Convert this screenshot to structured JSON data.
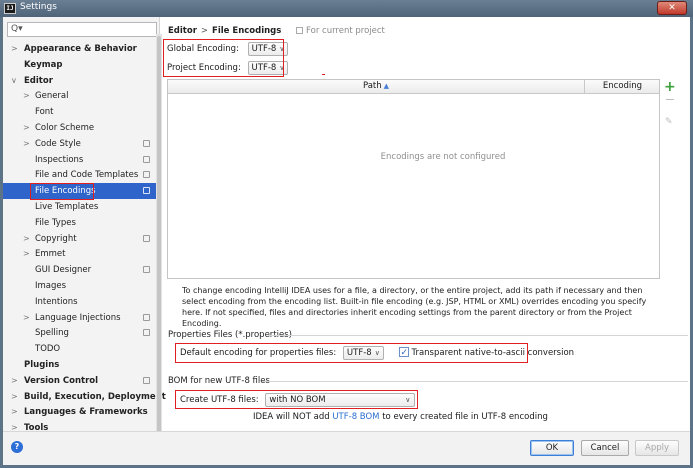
{
  "window": {
    "title": "Settings",
    "app_icon_text": "IJ",
    "close_symbol": "✕"
  },
  "sidebar": {
    "search_icon": "Q▾",
    "search_placeholder": "",
    "items": [
      {
        "label": "Appearance & Behavior",
        "chevron": ">",
        "bold": true
      },
      {
        "label": "Keymap",
        "bold": true
      },
      {
        "label": "Editor",
        "chevron": "∨",
        "bold": true
      },
      {
        "label": "General",
        "chevron": ">"
      },
      {
        "label": "Font"
      },
      {
        "label": "Color Scheme",
        "chevron": ">"
      },
      {
        "label": "Code Style",
        "chevron": ">",
        "project_icon": true
      },
      {
        "label": "Inspections",
        "project_icon": true
      },
      {
        "label": "File and Code Templates",
        "project_icon": true
      },
      {
        "label": "File Encodings",
        "project_icon": true,
        "selected": true
      },
      {
        "label": "Live Templates"
      },
      {
        "label": "File Types"
      },
      {
        "label": "Copyright",
        "chevron": ">",
        "project_icon": true
      },
      {
        "label": "Emmet",
        "chevron": ">"
      },
      {
        "label": "GUI Designer",
        "project_icon": true
      },
      {
        "label": "Images"
      },
      {
        "label": "Intentions"
      },
      {
        "label": "Language Injections",
        "chevron": ">",
        "project_icon": true
      },
      {
        "label": "Spelling",
        "project_icon": true
      },
      {
        "label": "TODO"
      },
      {
        "label": "Plugins",
        "bold": true
      },
      {
        "label": "Version Control",
        "chevron": ">",
        "bold": true,
        "project_icon": true
      },
      {
        "label": "Build, Execution, Deployment",
        "chevron": ">",
        "bold": true
      },
      {
        "label": "Languages & Frameworks",
        "chevron": ">",
        "bold": true
      },
      {
        "label": "Tools",
        "chevron": ">",
        "bold": true
      }
    ]
  },
  "breadcrumb": {
    "parent": "Editor",
    "separator": ">",
    "current": "File Encodings",
    "scope": "For current project"
  },
  "encodings": {
    "global_label": "Global Encoding:",
    "global_value": "UTF-8",
    "project_label": "Project Encoding:",
    "project_value": "UTF-8",
    "arrow": "∨"
  },
  "table": {
    "col_path": "Path",
    "sort_arrow": "▲",
    "col_encoding": "Encoding",
    "empty_message": "Encodings are not configured",
    "add": "+",
    "edit": "✎"
  },
  "note": "To change encoding IntelliJ IDEA uses for a file, a directory, or the entire project, add its path if necessary and then select encoding from the encoding list. Built-in file encoding (e.g. JSP, HTML or XML) overrides encoding you specify here. If not specified, files and directories inherit encoding settings from the parent directory or from the Project Encoding.",
  "properties": {
    "section_title": "Properties Files (*.properties)",
    "default_label": "Default encoding for properties files:",
    "default_value": "UTF-8",
    "checkbox_label": "Transparent native-to-ascii conversion",
    "checkbox_checked": true
  },
  "bom": {
    "section_title": "BOM for new UTF-8 files",
    "create_label": "Create UTF-8 files:",
    "create_value": "with NO BOM",
    "note_prefix": "IDEA will NOT add ",
    "note_link": "UTF-8 BOM",
    "note_suffix": " to every created file in UTF-8 encoding"
  },
  "buttons": {
    "help": "?",
    "ok": "OK",
    "cancel": "Cancel",
    "apply": "Apply"
  },
  "colors": {
    "selection": "#2f65ca",
    "highlight_box": "#e02020",
    "link": "#2a6fd0",
    "add_green": "#3aa03a"
  }
}
